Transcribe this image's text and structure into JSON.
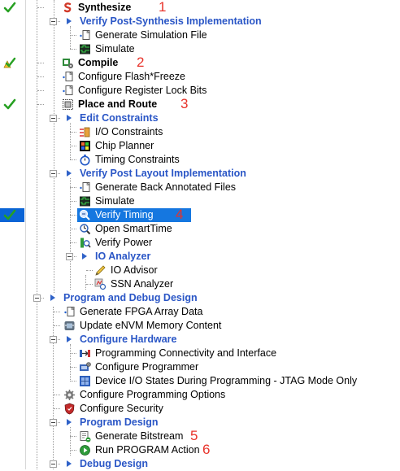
{
  "tree": {
    "items": [
      {
        "label": "Synthesize",
        "style": "bold",
        "icon": "synthesize-icon",
        "status": "check",
        "annotation": "1"
      },
      {
        "label": "Verify Post-Synthesis Implementation",
        "style": "category"
      },
      {
        "label": "Generate Simulation File",
        "icon": "new-file-icon"
      },
      {
        "label": "Simulate",
        "icon": "waveform-icon"
      },
      {
        "label": "Compile",
        "style": "bold",
        "icon": "compile-icon",
        "status": "warning-check",
        "annotation": "2"
      },
      {
        "label": "Configure Flash*Freeze",
        "icon": "new-file-icon"
      },
      {
        "label": "Configure Register Lock Bits",
        "icon": "new-file-icon"
      },
      {
        "label": "Place and Route",
        "style": "bold",
        "icon": "place-route-icon",
        "status": "check",
        "annotation": "3"
      },
      {
        "label": "Edit Constraints",
        "style": "category"
      },
      {
        "label": "I/O Constraints",
        "icon": "io-constraints-icon"
      },
      {
        "label": "Chip Planner",
        "icon": "chip-planner-icon"
      },
      {
        "label": "Timing Constraints",
        "icon": "stopwatch-icon"
      },
      {
        "label": "Verify Post Layout Implementation",
        "style": "category"
      },
      {
        "label": "Generate Back Annotated Files",
        "icon": "new-file-icon"
      },
      {
        "label": "Simulate",
        "icon": "waveform-icon"
      },
      {
        "label": "Verify Timing",
        "icon": "verify-timing-icon",
        "status": "check",
        "selected": true,
        "annotation": "4"
      },
      {
        "label": "Open SmartTime",
        "icon": "smarttime-icon"
      },
      {
        "label": "Verify Power",
        "icon": "power-icon"
      },
      {
        "label": "IO Analyzer",
        "style": "category"
      },
      {
        "label": "IO Advisor",
        "icon": "pencil-icon"
      },
      {
        "label": "SSN Analyzer",
        "icon": "ssn-icon"
      },
      {
        "label": "Program and Debug Design",
        "style": "category"
      },
      {
        "label": "Generate FPGA Array Data",
        "icon": "new-file-icon"
      },
      {
        "label": "Update eNVM Memory Content",
        "icon": "memory-icon"
      },
      {
        "label": "Configure Hardware",
        "style": "category"
      },
      {
        "label": "Programming Connectivity and Interface",
        "icon": "connectivity-icon"
      },
      {
        "label": "Configure Programmer",
        "icon": "programmer-icon"
      },
      {
        "label": "Device I/O States During Programming - JTAG Mode Only",
        "icon": "io-states-icon"
      },
      {
        "label": "Configure Programming Options",
        "icon": "gear-icon"
      },
      {
        "label": "Configure Security",
        "icon": "shield-icon"
      },
      {
        "label": "Program Design",
        "style": "category"
      },
      {
        "label": "Generate Bitstream",
        "icon": "bitstream-icon",
        "annotation": "5"
      },
      {
        "label": "Run PROGRAM Action",
        "icon": "run-icon",
        "annotation": "6"
      },
      {
        "label": "Debug Design",
        "style": "category"
      }
    ]
  },
  "colors": {
    "category_text": "#2a56c6",
    "selection": "#1577e0",
    "annotation": "#e8322a",
    "check": "#27a022"
  }
}
